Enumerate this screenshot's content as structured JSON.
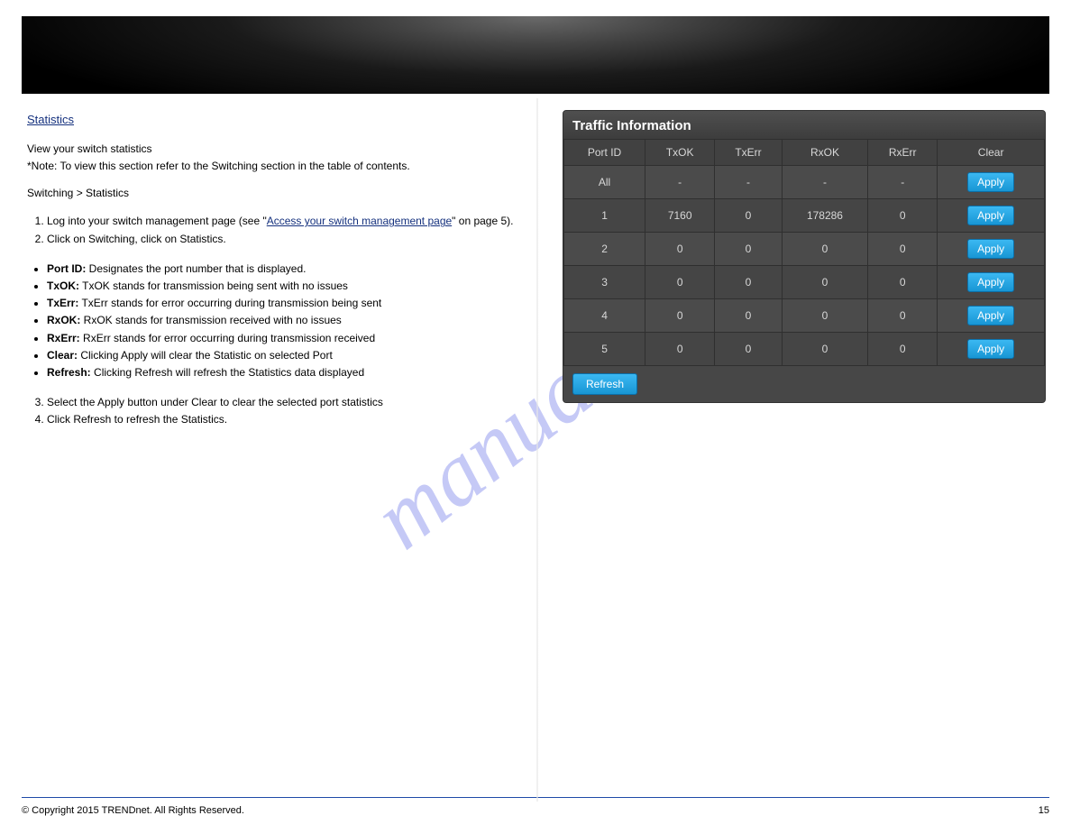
{
  "watermark": "manualshive.com",
  "left": {
    "stats_link": "Statistics",
    "view_title": "View your switch statistics",
    "view_text": "*Note: To view this section refer to the Switching section in the table of contents.",
    "s1_text": "Switching > Statistics",
    "steps1": {
      "a": "Log into your switch management page (see \"",
      "link": "Access your switch management page",
      "b": "\" on page 5).",
      "c": "Click on Switching, click on Statistics."
    },
    "bullets": {
      "port": {
        "k": "Port ID:",
        "v": " Designates the port number that is displayed."
      },
      "txok": {
        "k": "TxOK:",
        "v": " TxOK stands for transmission being sent with no issues"
      },
      "txerr": {
        "k": "TxErr:",
        "v": " TxErr stands for error occurring during transmission being sent"
      },
      "rxok": {
        "k": "RxOK:",
        "v": " RxOK stands for transmission received with no issues"
      },
      "rxerr": {
        "k": "RxErr:",
        "v": " RxErr stands for error occurring during transmission received"
      },
      "clear": {
        "k": "Clear:",
        "v": " Clicking Apply will clear the Statistic on selected Port"
      },
      "refresh": {
        "k": "Refresh:",
        "v": " Clicking Refresh will refresh the Statistics data displayed"
      }
    },
    "steps2": {
      "a": "Select the Apply button under Clear to clear the selected port statistics",
      "b": "Click Refresh to refresh the Statistics."
    }
  },
  "panel": {
    "title": "Traffic Information",
    "headers": [
      "Port ID",
      "TxOK",
      "TxErr",
      "RxOK",
      "RxErr",
      "Clear"
    ],
    "rows": [
      {
        "id": "All",
        "txok": "-",
        "txerr": "-",
        "rxok": "-",
        "rxerr": "-"
      },
      {
        "id": "1",
        "txok": "7160",
        "txerr": "0",
        "rxok": "178286",
        "rxerr": "0"
      },
      {
        "id": "2",
        "txok": "0",
        "txerr": "0",
        "rxok": "0",
        "rxerr": "0"
      },
      {
        "id": "3",
        "txok": "0",
        "txerr": "0",
        "rxok": "0",
        "rxerr": "0"
      },
      {
        "id": "4",
        "txok": "0",
        "txerr": "0",
        "rxok": "0",
        "rxerr": "0"
      },
      {
        "id": "5",
        "txok": "0",
        "txerr": "0",
        "rxok": "0",
        "rxerr": "0"
      }
    ],
    "apply": "Apply",
    "refresh": "Refresh"
  },
  "footer": {
    "left": "© Copyright 2015 TRENDnet. All Rights Reserved.",
    "right": "15"
  }
}
